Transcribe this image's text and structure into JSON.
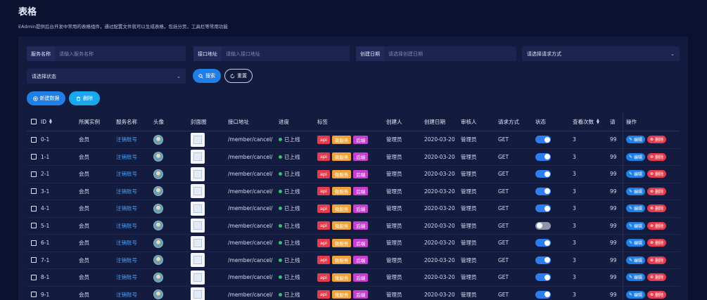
{
  "page": {
    "title": "表格",
    "description": "EAdmin提供后台开发中常用的表格组件，通过配置文件就可以生成表格，包括分页，工具栏等常用功能"
  },
  "filters": {
    "service_name": {
      "label": "服务名称",
      "placeholder": "请输入服务名称"
    },
    "api_address": {
      "label": "接口地址",
      "placeholder": "请输入接口地址"
    },
    "created_date": {
      "label": "创建日期",
      "placeholder": "请选择创建日期"
    },
    "request_method": {
      "placeholder": "请选择请求方式"
    },
    "status": {
      "placeholder": "请选择状态"
    },
    "search_label": "搜索",
    "reset_label": "重置"
  },
  "toolbar": {
    "add_label": "新建数据",
    "delete_label": "删除"
  },
  "table": {
    "headers": {
      "id": "ID",
      "instance": "所属实例",
      "service": "服务名称",
      "avatar": "头像",
      "cover": "封面图",
      "address": "接口地址",
      "progress": "进度",
      "tags": "标签",
      "creator": "创建人",
      "created_date": "创建日期",
      "auditor": "审核人",
      "method": "请求方式",
      "status": "状态",
      "views": "查看次数",
      "truncated": "请",
      "ops": "操作"
    },
    "tag_labels": {
      "api": "api",
      "micro": "微服务",
      "backend": "后端"
    },
    "op_labels": {
      "edit": "编辑",
      "delete": "删除"
    },
    "rows": [
      {
        "id": "0-1",
        "instance": "会员",
        "service": "注销账号",
        "address": "/member/cancel/",
        "progress": "已上线",
        "creator": "管理员",
        "date": "2020-03-20",
        "auditor": "管理员",
        "method": "GET",
        "status_on": true,
        "views": "3",
        "extra": "99"
      },
      {
        "id": "1-1",
        "instance": "会员",
        "service": "注销账号",
        "address": "/member/cancel/",
        "progress": "已上线",
        "creator": "管理员",
        "date": "2020-03-20",
        "auditor": "管理员",
        "method": "GET",
        "status_on": true,
        "views": "3",
        "extra": "99"
      },
      {
        "id": "2-1",
        "instance": "会员",
        "service": "注销账号",
        "address": "/member/cancel/",
        "progress": "已上线",
        "creator": "管理员",
        "date": "2020-03-20",
        "auditor": "管理员",
        "method": "GET",
        "status_on": true,
        "views": "3",
        "extra": "99"
      },
      {
        "id": "3-1",
        "instance": "会员",
        "service": "注销账号",
        "address": "/member/cancel/",
        "progress": "已上线",
        "creator": "管理员",
        "date": "2020-03-20",
        "auditor": "管理员",
        "method": "GET",
        "status_on": true,
        "views": "3",
        "extra": "99"
      },
      {
        "id": "4-1",
        "instance": "会员",
        "service": "注销账号",
        "address": "/member/cancel/",
        "progress": "已上线",
        "creator": "管理员",
        "date": "2020-03-20",
        "auditor": "管理员",
        "method": "GET",
        "status_on": true,
        "views": "3",
        "extra": "99"
      },
      {
        "id": "5-1",
        "instance": "会员",
        "service": "注销账号",
        "address": "/member/cancel/",
        "progress": "已上线",
        "creator": "管理员",
        "date": "2020-03-20",
        "auditor": "管理员",
        "method": "GET",
        "status_on": false,
        "views": "3",
        "extra": "99"
      },
      {
        "id": "6-1",
        "instance": "会员",
        "service": "注销账号",
        "address": "/member/cancel/",
        "progress": "已上线",
        "creator": "管理员",
        "date": "2020-03-20",
        "auditor": "管理员",
        "method": "GET",
        "status_on": true,
        "views": "3",
        "extra": "99"
      },
      {
        "id": "7-1",
        "instance": "会员",
        "service": "注销账号",
        "address": "/member/cancel/",
        "progress": "已上线",
        "creator": "管理员",
        "date": "2020-03-20",
        "auditor": "管理员",
        "method": "GET",
        "status_on": true,
        "views": "3",
        "extra": "99"
      },
      {
        "id": "8-1",
        "instance": "会员",
        "service": "注销账号",
        "address": "/member/cancel/",
        "progress": "已上线",
        "creator": "管理员",
        "date": "2020-03-20",
        "auditor": "管理员",
        "method": "GET",
        "status_on": true,
        "views": "3",
        "extra": "99"
      },
      {
        "id": "9-1",
        "instance": "会员",
        "service": "注销账号",
        "address": "/member/cancel/",
        "progress": "已上线",
        "creator": "管理员",
        "date": "2020-03-20",
        "auditor": "管理员",
        "method": "GET",
        "status_on": true,
        "views": "3",
        "extra": "99"
      }
    ]
  },
  "colors": {
    "background": "#0b1230",
    "panel": "#131c3f",
    "primary": "#1f7fe6",
    "danger": "#e23c4e",
    "warning": "#eea23a",
    "purple": "#c640d0",
    "success": "#39c26d",
    "link": "#4aa3ff"
  },
  "icons": {
    "search": "search-icon",
    "reset": "refresh-icon",
    "add": "plus-circle-icon",
    "delete": "trash-icon",
    "edit": "edit-icon",
    "sort": "sort-icon",
    "dropdown": "chevron-down-icon"
  }
}
